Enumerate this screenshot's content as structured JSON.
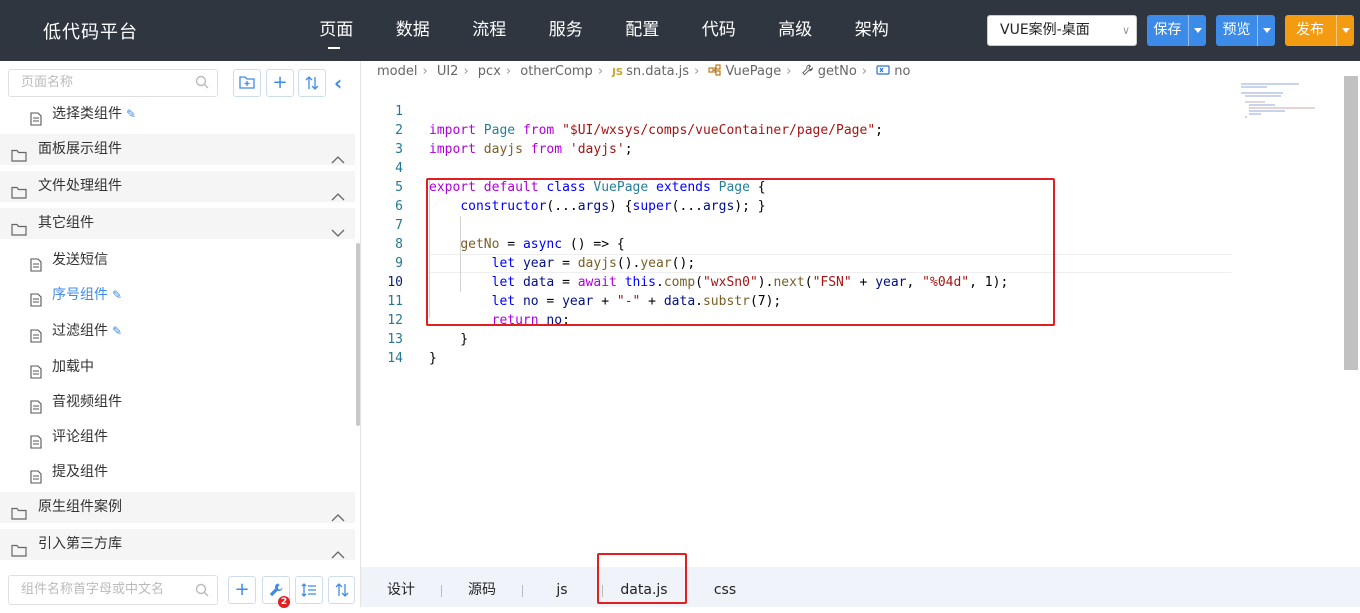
{
  "header": {
    "brand": "低代码平台",
    "nav": [
      "页面",
      "数据",
      "流程",
      "服务",
      "配置",
      "代码",
      "高级",
      "架构"
    ],
    "active_nav": "页面",
    "app_select": "VUE案例-桌面",
    "save_label": "保存",
    "preview_label": "预览",
    "publish_label": "发布"
  },
  "sidebar": {
    "page_search_placeholder": "页面名称",
    "component_search_placeholder": "组件名称首字母或中文名",
    "badge_count": "2",
    "items": [
      {
        "type": "leaf",
        "label": "选择类组件",
        "editable": true
      },
      {
        "type": "group",
        "label": "面板展示组件",
        "expanded": false
      },
      {
        "type": "group",
        "label": "文件处理组件",
        "expanded": false
      },
      {
        "type": "group",
        "label": "其它组件",
        "expanded": true
      },
      {
        "type": "leaf",
        "label": "发送短信",
        "editable": false
      },
      {
        "type": "leaf",
        "label": "序号组件",
        "editable": true,
        "selected": true
      },
      {
        "type": "leaf",
        "label": "过滤组件",
        "editable": true
      },
      {
        "type": "leaf",
        "label": "加载中",
        "editable": false
      },
      {
        "type": "leaf",
        "label": "音视频组件",
        "editable": false
      },
      {
        "type": "leaf",
        "label": "评论组件",
        "editable": false
      },
      {
        "type": "leaf",
        "label": "提及组件",
        "editable": false
      },
      {
        "type": "group",
        "label": "原生组件案例",
        "expanded": false
      },
      {
        "type": "group",
        "label": "引入第三方库",
        "expanded": false
      }
    ]
  },
  "breadcrumb": [
    "model",
    "UI2",
    "pcx",
    "otherComp",
    "sn.data.js",
    "VuePage",
    "getNo",
    "no"
  ],
  "editor": {
    "current_line": 10,
    "line_numbers": [
      "1",
      "2",
      "3",
      "4",
      "5",
      "6",
      "7",
      "8",
      "9",
      "10",
      "11",
      "12",
      "13",
      "14"
    ],
    "lines": [
      "import Page from \"$UI/wxsys/comps/vueContainer/page/Page\";",
      "import dayjs from 'dayjs';",
      "",
      "export default class VuePage extends Page {",
      "    constructor(...args) {super(...args); }",
      "",
      "    getNo = async () => {",
      "        let year = dayjs().year();",
      "        let data = await this.comp(\"wxSn0\").next(\"FSN\" + year, \"%04d\", 1);",
      "        let no = year + \"-\" + data.substr(7);",
      "        return no;",
      "    }",
      "}",
      ""
    ]
  },
  "bottom_tabs": [
    "设计",
    "源码",
    "js",
    "data.js",
    "css"
  ],
  "active_tab": "data.js",
  "colors": {
    "topbar": "#2f3640",
    "accent": "#3d8be8",
    "publish": "#f39c12",
    "highlight_box": "#e02020"
  }
}
